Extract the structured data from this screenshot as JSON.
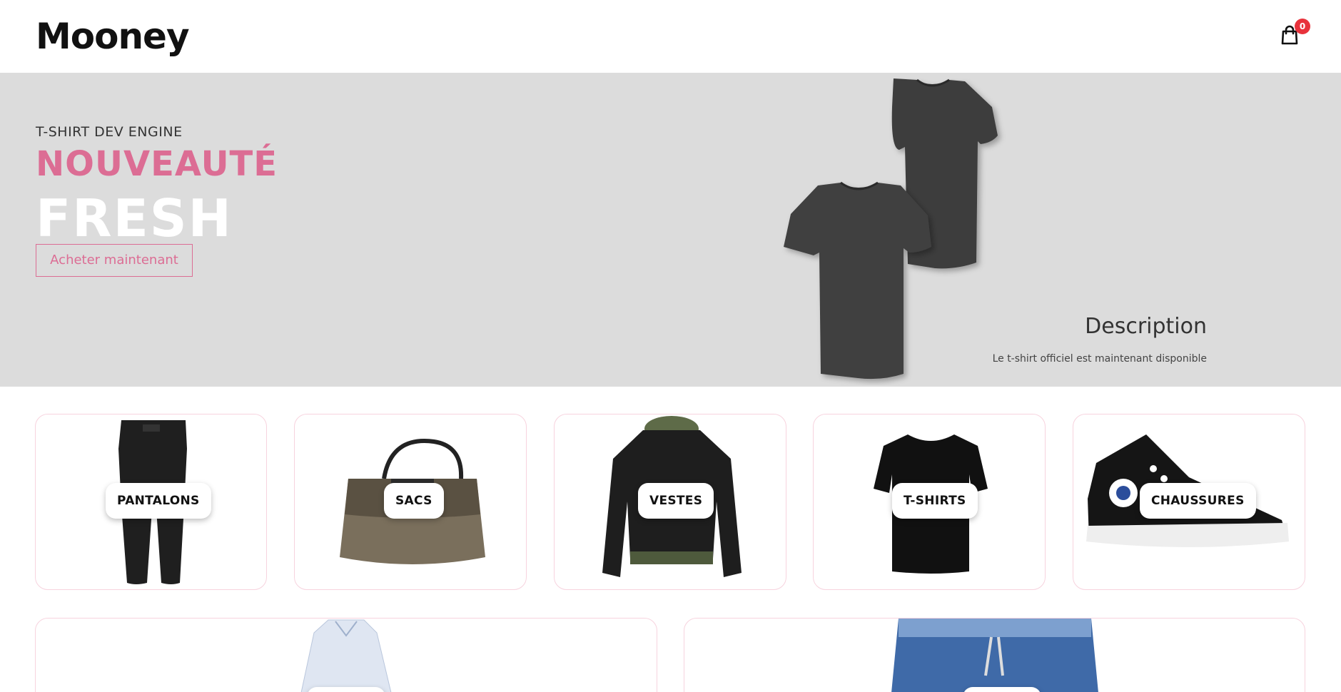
{
  "header": {
    "logo": "Mooney",
    "cart_count": "0"
  },
  "hero": {
    "eyebrow": "T-SHIRT DEV ENGINE",
    "title": "NOUVEAUTÉ",
    "subtitle": "FRESH",
    "cta_label": "Acheter maintenant",
    "description_title": "Description",
    "description_text": "Le t-shirt officiel est maintenant disponible"
  },
  "categories": [
    {
      "label": "PANTALONS"
    },
    {
      "label": "SACS"
    },
    {
      "label": "VESTES"
    },
    {
      "label": "T-SHIRTS"
    },
    {
      "label": "CHAUSSURES"
    },
    {
      "label": ""
    },
    {
      "label": ""
    }
  ],
  "colors": {
    "accent": "#dc6d94",
    "hero_bg": "#dcdcdc",
    "badge": "#e8323c",
    "card_border": "#f7d3de"
  }
}
